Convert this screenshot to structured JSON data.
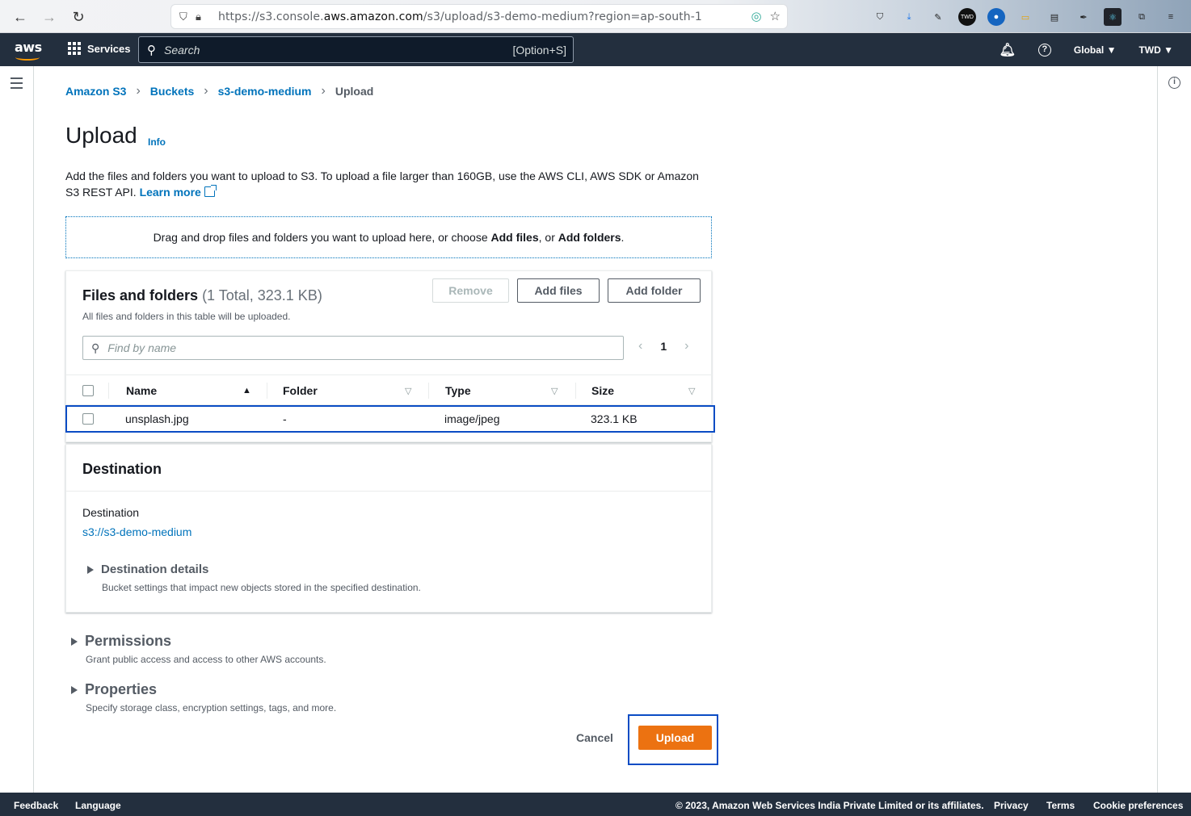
{
  "browser": {
    "url_prefix": "https://s3.console.",
    "url_domain": "aws.amazon.com",
    "url_path": "/s3/upload/s3-demo-medium?region=ap-south-1"
  },
  "aws_nav": {
    "logo": "aws",
    "services_label": "Services",
    "search_placeholder": "Search",
    "search_shortcut": "[Option+S]",
    "region_label": "Global ▼",
    "account_label": "TWD ▼"
  },
  "breadcrumb": {
    "items": [
      "Amazon S3",
      "Buckets",
      "s3-demo-medium",
      "Upload"
    ]
  },
  "page": {
    "title": "Upload",
    "info_label": "Info",
    "desc_line1": "Add the files and folders you want to upload to S3. To upload a file larger than 160GB, use the AWS CLI, AWS SDK or Amazon",
    "desc_line2": "S3 REST API.",
    "learn_more": "Learn more"
  },
  "dropzone": {
    "text_before": "Drag and drop files and folders you want to upload here, or choose ",
    "add_files": "Add files",
    "text_mid": ", or ",
    "add_folders": "Add folders",
    "text_end": "."
  },
  "files": {
    "title": "Files and folders",
    "count": "(1 Total, 323.1 KB)",
    "subtitle": "All files and folders in this table will be uploaded.",
    "remove_label": "Remove",
    "add_files_label": "Add files",
    "add_folder_label": "Add folder",
    "find_placeholder": "Find by name",
    "page_number": "1",
    "columns": [
      "Name",
      "Folder",
      "Type",
      "Size"
    ],
    "rows": [
      {
        "name": "unsplash.jpg",
        "folder": "-",
        "type": "image/jpeg",
        "size": "323.1 KB"
      }
    ]
  },
  "destination": {
    "title": "Destination",
    "label": "Destination",
    "link": "s3://s3-demo-medium",
    "details_title": "Destination details",
    "details_sub": "Bucket settings that impact new objects stored in the specified destination."
  },
  "permissions": {
    "title": "Permissions",
    "sub": "Grant public access and access to other AWS accounts."
  },
  "properties": {
    "title": "Properties",
    "sub": "Specify storage class, encryption settings, tags, and more."
  },
  "actions": {
    "cancel": "Cancel",
    "upload": "Upload"
  },
  "footer": {
    "feedback": "Feedback",
    "language": "Language",
    "copyright": "© 2023, Amazon Web Services India Private Limited or its affiliates.",
    "privacy": "Privacy",
    "terms": "Terms",
    "cookies": "Cookie preferences"
  },
  "colors": {
    "aws_nav_bg": "#232f3e",
    "link_blue": "#0073bb",
    "upload_orange": "#ec7211",
    "focus_blue": "#0a4cc4"
  }
}
